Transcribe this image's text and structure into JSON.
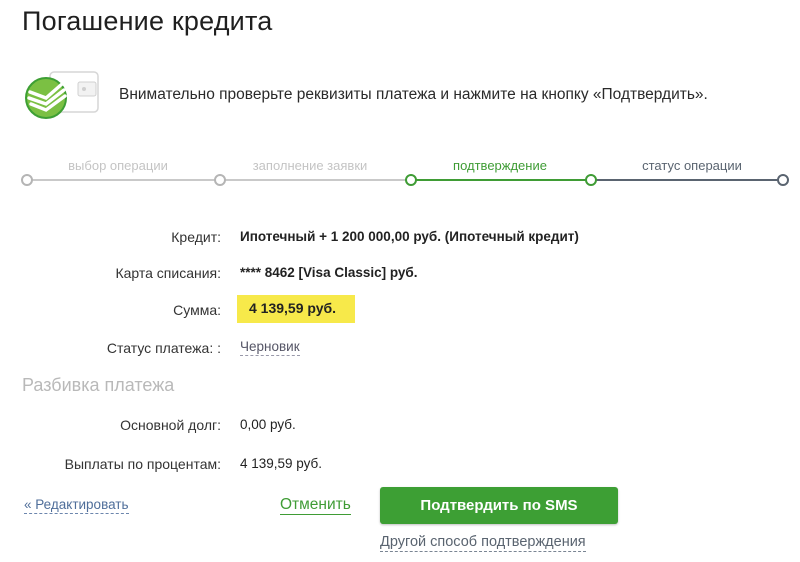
{
  "page": {
    "title": "Погашение кредита"
  },
  "info": {
    "text": "Внимательно проверьте реквизиты платежа и нажмите на кнопку «Подтвердить»."
  },
  "colors": {
    "brand_green": "#3d9f34",
    "highlight_yellow": "#f7e94a",
    "step_done": "#c4c4c4",
    "step_next": "#5a6470"
  },
  "stepper": {
    "steps": [
      {
        "label": "выбор операции",
        "state": "done"
      },
      {
        "label": "заполнение заявки",
        "state": "done"
      },
      {
        "label": "подтверждение",
        "state": "active"
      },
      {
        "label": "статус операции",
        "state": "pending"
      }
    ]
  },
  "details": {
    "credit_label": "Кредит:",
    "credit_value": "Ипотечный + 1 200 000,00 руб. (Ипотечный кредит)",
    "card_label": "Карта списания:",
    "card_value": "**** 8462 [Visa Classic] руб.",
    "sum_label": "Сумма:",
    "sum_value": "4 139,59 руб.",
    "status_label": "Статус платежа: :",
    "status_value": "Черновик"
  },
  "breakdown": {
    "title": "Разбивка платежа",
    "principal_label": "Основной долг:",
    "principal_value": "0,00 руб.",
    "interest_label": "Выплаты по процентам:",
    "interest_value": "4 139,59 руб."
  },
  "actions": {
    "edit_label": "« Редактировать",
    "cancel_label": "Отменить",
    "confirm_label": "Подтвердить по SMS",
    "other_method_label": "Другой способ подтверждения"
  },
  "icons": {
    "logo": "sberbank-logo-icon",
    "wallet": "wallet-icon"
  }
}
